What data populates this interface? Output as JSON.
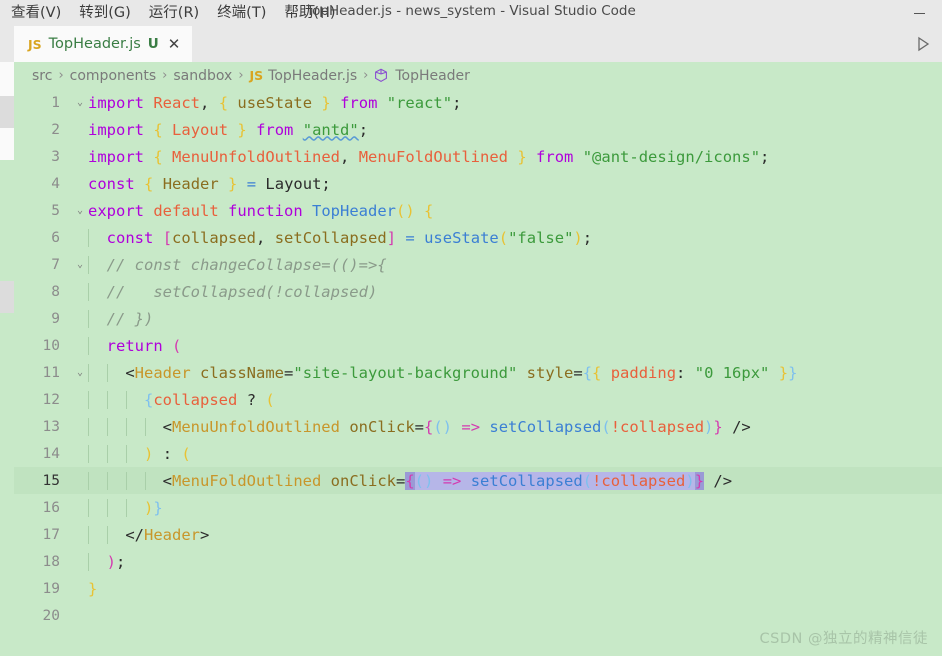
{
  "window": {
    "title": "TopHeader.js - news_system - Visual Studio Code",
    "minimize_label": "—"
  },
  "menubar": {
    "items": [
      {
        "label": "查看(V)",
        "name": "menu-view"
      },
      {
        "label": "转到(G)",
        "name": "menu-goto"
      },
      {
        "label": "运行(R)",
        "name": "menu-run"
      },
      {
        "label": "终端(T)",
        "name": "menu-terminal"
      },
      {
        "label": "帮助(H)",
        "name": "menu-help"
      }
    ]
  },
  "tab": {
    "icon_label": "JS",
    "filename": "TopHeader.js",
    "badge": "U",
    "close": "✕"
  },
  "toolbar": {
    "run_title": "Run Code"
  },
  "breadcrumb": {
    "items": [
      "src",
      "components",
      "sandbox",
      "TopHeader.js",
      "TopHeader"
    ],
    "file_icon": "JS",
    "symbol_icon": "cube-icon",
    "separator": "›"
  },
  "editor": {
    "current_line": 15,
    "total_lines": 20,
    "line_numbers": [
      1,
      2,
      3,
      4,
      5,
      6,
      7,
      8,
      9,
      10,
      11,
      12,
      13,
      14,
      15,
      16,
      17,
      18,
      19,
      20
    ],
    "lines_text": [
      "import React, { useState } from \"react\";",
      "import { Layout } from \"antd\";",
      "import { MenuUnfoldOutlined, MenuFoldOutlined } from \"@ant-design/icons\";",
      "const { Header } = Layout;",
      "export default function TopHeader() {",
      "  const [collapsed, setCollapsed] = useState(\"false\");",
      "  // const changeCollapse=(()=>{",
      "  //   setCollapsed(!collapsed)",
      "  // })",
      "  return (",
      "    <Header className=\"site-layout-background\" style={{ padding: \"0 16px\" }}",
      "      {collapsed ? (",
      "        <MenuUnfoldOutlined onClick={() => setCollapsed(!collapsed)} />",
      "      ) : (",
      "        <MenuFoldOutlined onClick={() => setCollapsed(!collapsed)} />",
      "      )}",
      "    </Header>",
      "  );",
      "}",
      ""
    ],
    "selection_text": "{() => setCollapsed(!collapsed)}"
  },
  "watermark": {
    "text": "CSDN @独立的精神信徒"
  },
  "colors": {
    "editor_background": "#c8e9c8",
    "chrome_background": "#e8e8e8",
    "tab_active_background": "#fafafa",
    "keyword": "#af00db",
    "string": "#3c9a3c",
    "comment": "#8a9a8a",
    "function": "#3b7fd4",
    "variable": "#8a6d1f",
    "tag": "#c8962a",
    "selection": "#b6b6e8"
  }
}
